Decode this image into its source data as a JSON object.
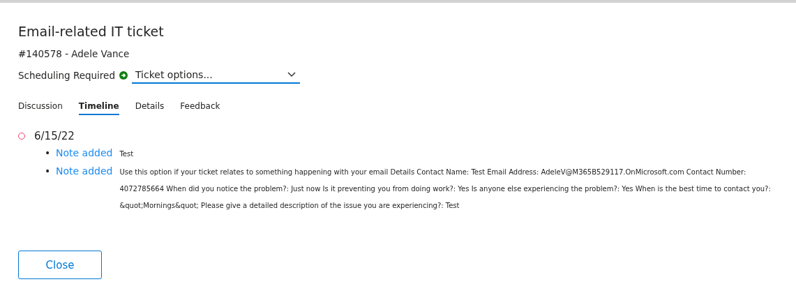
{
  "title": "Email-related IT ticket",
  "subtitle": "#140578 - Adele Vance",
  "status": "Scheduling Required",
  "options": {
    "value": "Ticket options..."
  },
  "tabs": [
    {
      "label": "Discussion",
      "selected": false
    },
    {
      "label": "Timeline",
      "selected": true
    },
    {
      "label": "Details",
      "selected": false
    },
    {
      "label": "Feedback",
      "selected": false
    }
  ],
  "timeline": [
    {
      "date": "6/15/22",
      "entries": [
        {
          "bullet": "•",
          "link": "Note added",
          "text": "Test"
        },
        {
          "bullet": "•",
          "link": "Note added",
          "text": "Use this option if your ticket relates to something happening with your email Details Contact Name: Test Email Address: AdeleV@M365B529117.OnMicrosoft.com Contact Number: 4072785664 When did you notice the problem?: Just now Is it preventing you from doing work?: Yes Is anyone else experiencing the problem?: Yes When is the best time to contact you?: &quot;Mornings&quot; Please give a detailed description of the issue you are experiencing?: Test"
        }
      ]
    }
  ],
  "buttons": [
    {
      "label": "Close"
    }
  ]
}
